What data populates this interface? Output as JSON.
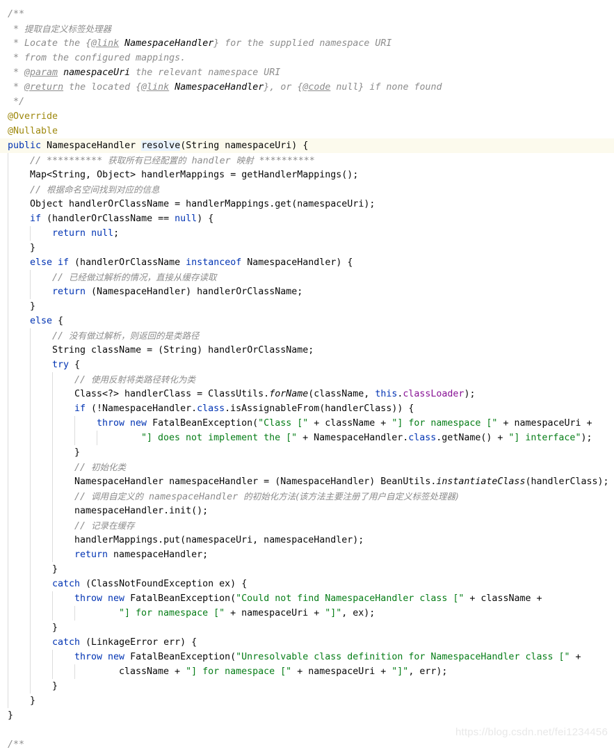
{
  "editor": {
    "language": "java",
    "lines": [
      {
        "indent": 0,
        "tokens": [
          {
            "t": "cm",
            "v": "/**"
          }
        ]
      },
      {
        "indent": 0,
        "tokens": [
          {
            "t": "cm",
            "v": " * "
          },
          {
            "t": "cn",
            "v": "提取自定义标签处理器"
          }
        ]
      },
      {
        "indent": 0,
        "tokens": [
          {
            "t": "cm",
            "v": " * Locate the {"
          },
          {
            "t": "tag",
            "v": "@link"
          },
          {
            "t": "cm",
            "v": " "
          },
          {
            "t": "ref",
            "v": "NamespaceHandler"
          },
          {
            "t": "cm",
            "v": "} for the supplied namespace URI"
          }
        ]
      },
      {
        "indent": 0,
        "tokens": [
          {
            "t": "cm",
            "v": " * from the configured mappings."
          }
        ]
      },
      {
        "indent": 0,
        "tokens": [
          {
            "t": "cm",
            "v": " * "
          },
          {
            "t": "tag",
            "v": "@param"
          },
          {
            "t": "cm",
            "v": " "
          },
          {
            "t": "ref",
            "v": "namespaceUri"
          },
          {
            "t": "cm",
            "v": " the relevant namespace URI"
          }
        ]
      },
      {
        "indent": 0,
        "tokens": [
          {
            "t": "cm",
            "v": " * "
          },
          {
            "t": "tag",
            "v": "@return"
          },
          {
            "t": "cm",
            "v": " the located {"
          },
          {
            "t": "tag",
            "v": "@link"
          },
          {
            "t": "cm",
            "v": " "
          },
          {
            "t": "ref",
            "v": "NamespaceHandler"
          },
          {
            "t": "cm",
            "v": "}, or {"
          },
          {
            "t": "tag",
            "v": "@code"
          },
          {
            "t": "cm",
            "v": " null} if none found"
          }
        ]
      },
      {
        "indent": 0,
        "tokens": [
          {
            "t": "cm",
            "v": " */"
          }
        ]
      },
      {
        "indent": 0,
        "tokens": [
          {
            "t": "ann",
            "v": "@Override"
          }
        ]
      },
      {
        "indent": 0,
        "tokens": [
          {
            "t": "ann",
            "v": "@Nullable"
          }
        ]
      },
      {
        "indent": 0,
        "caret": true,
        "tokens": [
          {
            "t": "kw",
            "v": "public"
          },
          {
            "t": "def",
            "v": " NamespaceHandler "
          },
          {
            "t": "hl",
            "v": "resolve"
          },
          {
            "t": "def",
            "v": "(String namespaceUri) {"
          }
        ]
      },
      {
        "indent": 1,
        "tokens": [
          {
            "t": "cm",
            "v": "// ********** "
          },
          {
            "t": "cn",
            "v": "获取所有已经配置的"
          },
          {
            "t": "cm",
            "v": " handler "
          },
          {
            "t": "cn",
            "v": "映射"
          },
          {
            "t": "cm",
            "v": " **********"
          }
        ]
      },
      {
        "indent": 1,
        "tokens": [
          {
            "t": "def",
            "v": "Map<String, Object> handlerMappings = getHandlerMappings();"
          }
        ]
      },
      {
        "indent": 1,
        "tokens": [
          {
            "t": "cm",
            "v": "// "
          },
          {
            "t": "cn",
            "v": "根据命名空间找到对应的信息"
          }
        ]
      },
      {
        "indent": 1,
        "tokens": [
          {
            "t": "def",
            "v": "Object handlerOrClassName = handlerMappings.get(namespaceUri);"
          }
        ]
      },
      {
        "indent": 1,
        "tokens": [
          {
            "t": "kw",
            "v": "if"
          },
          {
            "t": "def",
            "v": " (handlerOrClassName == "
          },
          {
            "t": "kw",
            "v": "null"
          },
          {
            "t": "def",
            "v": ") {"
          }
        ]
      },
      {
        "indent": 2,
        "tokens": [
          {
            "t": "kw",
            "v": "return"
          },
          {
            "t": "def",
            "v": " "
          },
          {
            "t": "kw",
            "v": "null"
          },
          {
            "t": "def",
            "v": ";"
          }
        ]
      },
      {
        "indent": 1,
        "tokens": [
          {
            "t": "def",
            "v": "}"
          }
        ]
      },
      {
        "indent": 1,
        "tokens": [
          {
            "t": "kw",
            "v": "else if"
          },
          {
            "t": "def",
            "v": " (handlerOrClassName "
          },
          {
            "t": "kw",
            "v": "instanceof"
          },
          {
            "t": "def",
            "v": " NamespaceHandler) {"
          }
        ]
      },
      {
        "indent": 2,
        "tokens": [
          {
            "t": "cm",
            "v": "// "
          },
          {
            "t": "cn",
            "v": "已经做过解析的情况，直接从缓存读取"
          }
        ]
      },
      {
        "indent": 2,
        "tokens": [
          {
            "t": "kw",
            "v": "return"
          },
          {
            "t": "def",
            "v": " (NamespaceHandler) handlerOrClassName;"
          }
        ]
      },
      {
        "indent": 1,
        "tokens": [
          {
            "t": "def",
            "v": "}"
          }
        ]
      },
      {
        "indent": 1,
        "tokens": [
          {
            "t": "kw",
            "v": "else"
          },
          {
            "t": "def",
            "v": " {"
          }
        ]
      },
      {
        "indent": 2,
        "tokens": [
          {
            "t": "cm",
            "v": "// "
          },
          {
            "t": "cn",
            "v": "没有做过解析，则返回的是类路径"
          }
        ]
      },
      {
        "indent": 2,
        "tokens": [
          {
            "t": "def",
            "v": "String className = (String) handlerOrClassName;"
          }
        ]
      },
      {
        "indent": 2,
        "tokens": [
          {
            "t": "kw",
            "v": "try"
          },
          {
            "t": "def",
            "v": " {"
          }
        ]
      },
      {
        "indent": 3,
        "tokens": [
          {
            "t": "cm",
            "v": "// "
          },
          {
            "t": "cn",
            "v": "使用反射将类路径转化为类"
          }
        ]
      },
      {
        "indent": 3,
        "tokens": [
          {
            "t": "def",
            "v": "Class<?> handlerClass = ClassUtils."
          },
          {
            "t": "sm",
            "v": "forName"
          },
          {
            "t": "def",
            "v": "(className, "
          },
          {
            "t": "kw",
            "v": "this"
          },
          {
            "t": "def",
            "v": "."
          },
          {
            "t": "fld",
            "v": "classLoader"
          },
          {
            "t": "def",
            "v": ");"
          }
        ]
      },
      {
        "indent": 3,
        "tokens": [
          {
            "t": "kw",
            "v": "if"
          },
          {
            "t": "def",
            "v": " (!NamespaceHandler."
          },
          {
            "t": "kw",
            "v": "class"
          },
          {
            "t": "def",
            "v": ".isAssignableFrom(handlerClass)) {"
          }
        ]
      },
      {
        "indent": 4,
        "tokens": [
          {
            "t": "kw",
            "v": "throw new"
          },
          {
            "t": "def",
            "v": " FatalBeanException("
          },
          {
            "t": "str",
            "v": "\"Class [\""
          },
          {
            "t": "def",
            "v": " + className + "
          },
          {
            "t": "str",
            "v": "\"] for namespace [\""
          },
          {
            "t": "def",
            "v": " + namespaceUri +"
          }
        ]
      },
      {
        "indent": 4,
        "cont": true,
        "tokens": [
          {
            "t": "str",
            "v": "\"] does not implement the [\""
          },
          {
            "t": "def",
            "v": " + NamespaceHandler."
          },
          {
            "t": "kw",
            "v": "class"
          },
          {
            "t": "def",
            "v": ".getName() + "
          },
          {
            "t": "str",
            "v": "\"] interface\""
          },
          {
            "t": "def",
            "v": ");"
          }
        ]
      },
      {
        "indent": 3,
        "tokens": [
          {
            "t": "def",
            "v": "}"
          }
        ]
      },
      {
        "indent": 3,
        "tokens": [
          {
            "t": "cm",
            "v": "// "
          },
          {
            "t": "cn",
            "v": "初始化类"
          }
        ]
      },
      {
        "indent": 3,
        "tokens": [
          {
            "t": "def",
            "v": "NamespaceHandler namespaceHandler = (NamespaceHandler) BeanUtils."
          },
          {
            "t": "sm",
            "v": "instantiateClass"
          },
          {
            "t": "def",
            "v": "(handlerClass);"
          }
        ]
      },
      {
        "indent": 3,
        "tokens": [
          {
            "t": "cm",
            "v": "// "
          },
          {
            "t": "cn",
            "v": "调用自定义的"
          },
          {
            "t": "cm",
            "v": " namespaceHandler "
          },
          {
            "t": "cn",
            "v": "的初始化方法(该方法主要注册了用户自定义标签处理器)"
          }
        ]
      },
      {
        "indent": 3,
        "tokens": [
          {
            "t": "def",
            "v": "namespaceHandler.init();"
          }
        ]
      },
      {
        "indent": 3,
        "tokens": [
          {
            "t": "cm",
            "v": "// "
          },
          {
            "t": "cn",
            "v": "记录在缓存"
          }
        ]
      },
      {
        "indent": 3,
        "tokens": [
          {
            "t": "def",
            "v": "handlerMappings.put(namespaceUri, namespaceHandler);"
          }
        ]
      },
      {
        "indent": 3,
        "tokens": [
          {
            "t": "kw",
            "v": "return"
          },
          {
            "t": "def",
            "v": " namespaceHandler;"
          }
        ]
      },
      {
        "indent": 2,
        "tokens": [
          {
            "t": "def",
            "v": "}"
          }
        ]
      },
      {
        "indent": 2,
        "tokens": [
          {
            "t": "kw",
            "v": "catch"
          },
          {
            "t": "def",
            "v": " (ClassNotFoundException ex) {"
          }
        ]
      },
      {
        "indent": 3,
        "tokens": [
          {
            "t": "kw",
            "v": "throw new"
          },
          {
            "t": "def",
            "v": " FatalBeanException("
          },
          {
            "t": "str",
            "v": "\"Could not find NamespaceHandler class [\""
          },
          {
            "t": "def",
            "v": " + className +"
          }
        ]
      },
      {
        "indent": 3,
        "cont": true,
        "tokens": [
          {
            "t": "str",
            "v": "\"] for namespace [\""
          },
          {
            "t": "def",
            "v": " + namespaceUri + "
          },
          {
            "t": "str",
            "v": "\"]\""
          },
          {
            "t": "def",
            "v": ", ex);"
          }
        ]
      },
      {
        "indent": 2,
        "tokens": [
          {
            "t": "def",
            "v": "}"
          }
        ]
      },
      {
        "indent": 2,
        "tokens": [
          {
            "t": "kw",
            "v": "catch"
          },
          {
            "t": "def",
            "v": " (LinkageError err) {"
          }
        ]
      },
      {
        "indent": 3,
        "tokens": [
          {
            "t": "kw",
            "v": "throw new"
          },
          {
            "t": "def",
            "v": " FatalBeanException("
          },
          {
            "t": "str",
            "v": "\"Unresolvable class definition for NamespaceHandler class [\""
          },
          {
            "t": "def",
            "v": " +"
          }
        ]
      },
      {
        "indent": 3,
        "cont": true,
        "tokens": [
          {
            "t": "def",
            "v": "className + "
          },
          {
            "t": "str",
            "v": "\"] for namespace [\""
          },
          {
            "t": "def",
            "v": " + namespaceUri + "
          },
          {
            "t": "str",
            "v": "\"]\""
          },
          {
            "t": "def",
            "v": ", err);"
          }
        ]
      },
      {
        "indent": 2,
        "tokens": [
          {
            "t": "def",
            "v": "}"
          }
        ]
      },
      {
        "indent": 1,
        "tokens": [
          {
            "t": "def",
            "v": "}"
          }
        ]
      },
      {
        "indent": 0,
        "tokens": [
          {
            "t": "def",
            "v": "}"
          }
        ]
      },
      {
        "indent": 0,
        "tokens": []
      },
      {
        "indent": 0,
        "tokens": [
          {
            "t": "cm",
            "v": "/**"
          }
        ]
      }
    ]
  },
  "watermark": "https://blog.csdn.net/fei1234456"
}
